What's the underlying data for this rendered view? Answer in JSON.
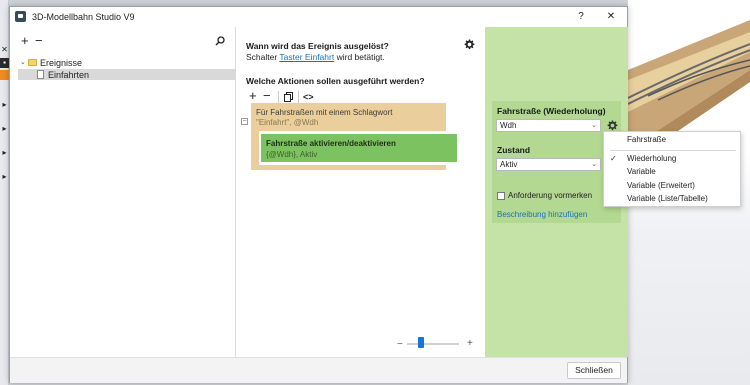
{
  "window": {
    "title": "3D-Modellbahn Studio V9",
    "help_label": "?",
    "close_label": "✕"
  },
  "left_toolbar": {
    "add_label": "+",
    "remove_label": "−",
    "search_icon": "search-icon"
  },
  "tree": {
    "root_label": "Ereignisse",
    "child_label": "Einfahrten"
  },
  "trigger": {
    "heading": "Wann wird das Ereignis ausgelöst?",
    "prefix": "Schalter",
    "link": "Taster Einfahrt",
    "suffix": "wird betätigt."
  },
  "actions": {
    "heading": "Welche Aktionen sollen ausgeführt werden?",
    "toolbar": {
      "add": "+",
      "remove": "−",
      "copy_icon": "copy-icon",
      "code": "<>"
    },
    "loop": {
      "title": "Für Fahrstraßen mit einem Schlagwort",
      "params": "\"Einfahrt\", @Wdh"
    },
    "action": {
      "title": "Fahrstraße aktivieren/deaktivieren",
      "params": "{@Wdh}, Aktiv"
    },
    "collapse": "−"
  },
  "zoom": {
    "minus": "−",
    "plus": "+",
    "level": 0.2
  },
  "properties": {
    "fahrstrasse_label": "Fahrstraße (Wiederholung)",
    "fahrstrasse_value": "Wdh",
    "zustand_label": "Zustand",
    "zustand_value": "Aktiv",
    "checkbox_label": "Anforderung vormerken",
    "checkbox_checked": false,
    "description_link": "Beschreibung hinzufügen"
  },
  "dropdown": {
    "items": [
      {
        "label": "Fahrstraße",
        "checked": false
      },
      {
        "label": "Wiederholung",
        "checked": true
      },
      {
        "label": "Variable",
        "checked": false
      },
      {
        "label": "Variable (Erweitert)",
        "checked": false
      },
      {
        "label": "Variable (Liste/Tabelle)",
        "checked": false
      }
    ],
    "check_mark": "✓"
  },
  "footer": {
    "close_button": "Schließen"
  },
  "colors": {
    "event_block": "#eacf9c",
    "action_block": "#7dc261",
    "property_pane": "#c5e3a6",
    "accent": "#1a73d8"
  }
}
